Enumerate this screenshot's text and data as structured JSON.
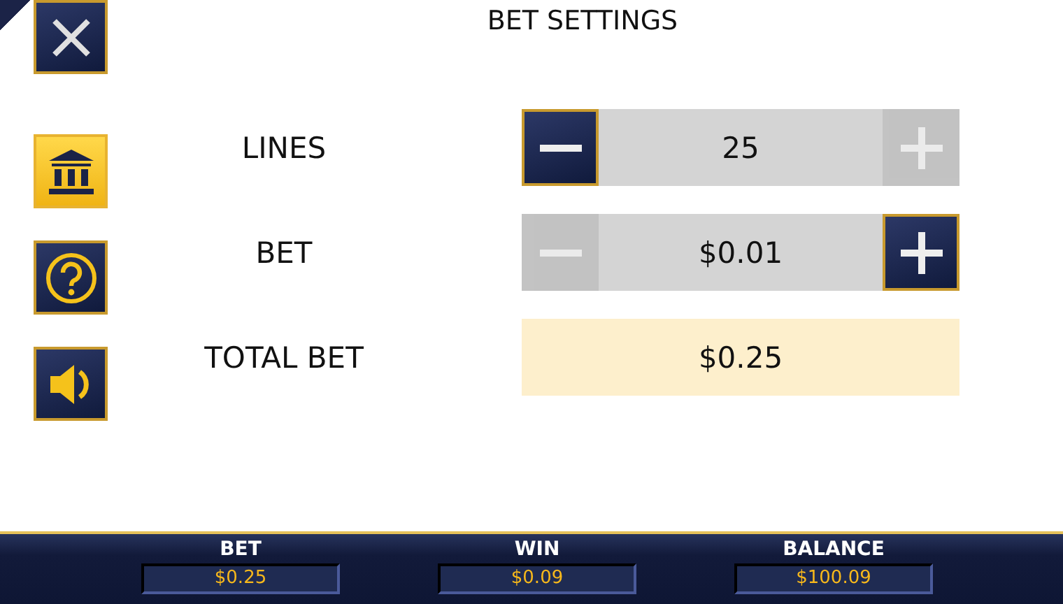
{
  "title": "BET SETTINGS",
  "sidebar": [
    {
      "kind": "close",
      "selected": false
    },
    {
      "kind": "paytable",
      "selected": true
    },
    {
      "kind": "help",
      "selected": false
    },
    {
      "kind": "sound",
      "selected": false
    }
  ],
  "rows": [
    {
      "kind": "stepper",
      "label": "LINES",
      "value": "25",
      "decrease_disabled": false,
      "increase_disabled": true
    },
    {
      "kind": "stepper",
      "label": "BET",
      "value": "$0.01",
      "decrease_disabled": true,
      "increase_disabled": false
    },
    {
      "kind": "total",
      "label": "TOTAL BET",
      "value": "$0.25"
    }
  ],
  "status_bar": [
    {
      "label": "BET",
      "value": "$0.25"
    },
    {
      "label": "WIN",
      "value": "$0.09"
    },
    {
      "label": "BALANCE",
      "value": "$100.09"
    }
  ]
}
